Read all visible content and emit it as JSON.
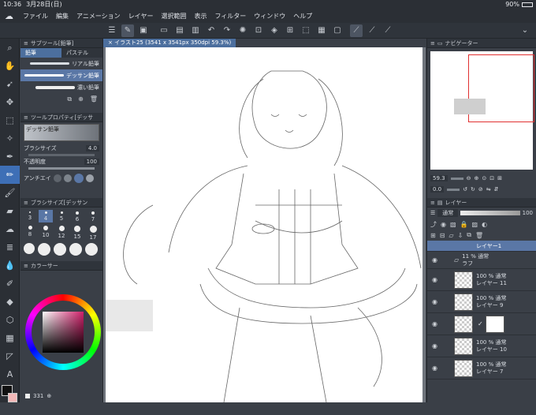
{
  "status": {
    "time": "10:36",
    "date": "3月28日(日)",
    "battery": "90%"
  },
  "menu": [
    "ファイル",
    "編集",
    "アニメーション",
    "レイヤー",
    "選択範囲",
    "表示",
    "フィルター",
    "ウィンドウ",
    "ヘルプ"
  ],
  "subtool": {
    "header": "サブツール[鉛筆]",
    "tabs": [
      "鉛筆",
      "パステル"
    ],
    "items": [
      "リアル鉛筆",
      "デッサン鉛筆",
      "濃い鉛筆"
    ]
  },
  "toolprop": {
    "header": "ツールプロパティ[デッサ",
    "brush_name": "デッサン鉛筆",
    "size_label": "ブラシサイズ",
    "size_value": "4.0",
    "opacity_label": "不透明度",
    "opacity_value": "100",
    "aa_label": "アンチエイ"
  },
  "brushsize": {
    "header": "ブラシサイズ[デッサン",
    "sizes": [
      "3",
      "4",
      "5",
      "6",
      "7",
      "8",
      "10",
      "12",
      "15",
      "17"
    ]
  },
  "color": {
    "header": "カラーサー",
    "main": "#111111",
    "sub": "#f2b8b8",
    "count": "331"
  },
  "canvas_tab": "イラスト25 (3541 x 3541px 350dpi 59.3%)",
  "navigator": {
    "title": "ナビゲーター",
    "zoom": "59.3",
    "rotate": "0.0"
  },
  "layers": {
    "title": "レイヤー",
    "blend": "通常",
    "opacity": "100",
    "items": [
      {
        "pct": "",
        "mode": "",
        "name": "レイヤー1",
        "selected": true
      },
      {
        "pct": "11 %",
        "mode": "通常",
        "name": "ラフ",
        "folder": true
      },
      {
        "pct": "100 %",
        "mode": "通常",
        "name": "レイヤー 11"
      },
      {
        "pct": "100 %",
        "mode": "通常",
        "name": "レイヤー 9"
      },
      {
        "pct": "",
        "mode": "",
        "name": "",
        "mask": true
      },
      {
        "pct": "100 %",
        "mode": "通常",
        "name": "レイヤー 10"
      },
      {
        "pct": "100 %",
        "mode": "通常",
        "name": "レイヤー 7"
      }
    ]
  }
}
